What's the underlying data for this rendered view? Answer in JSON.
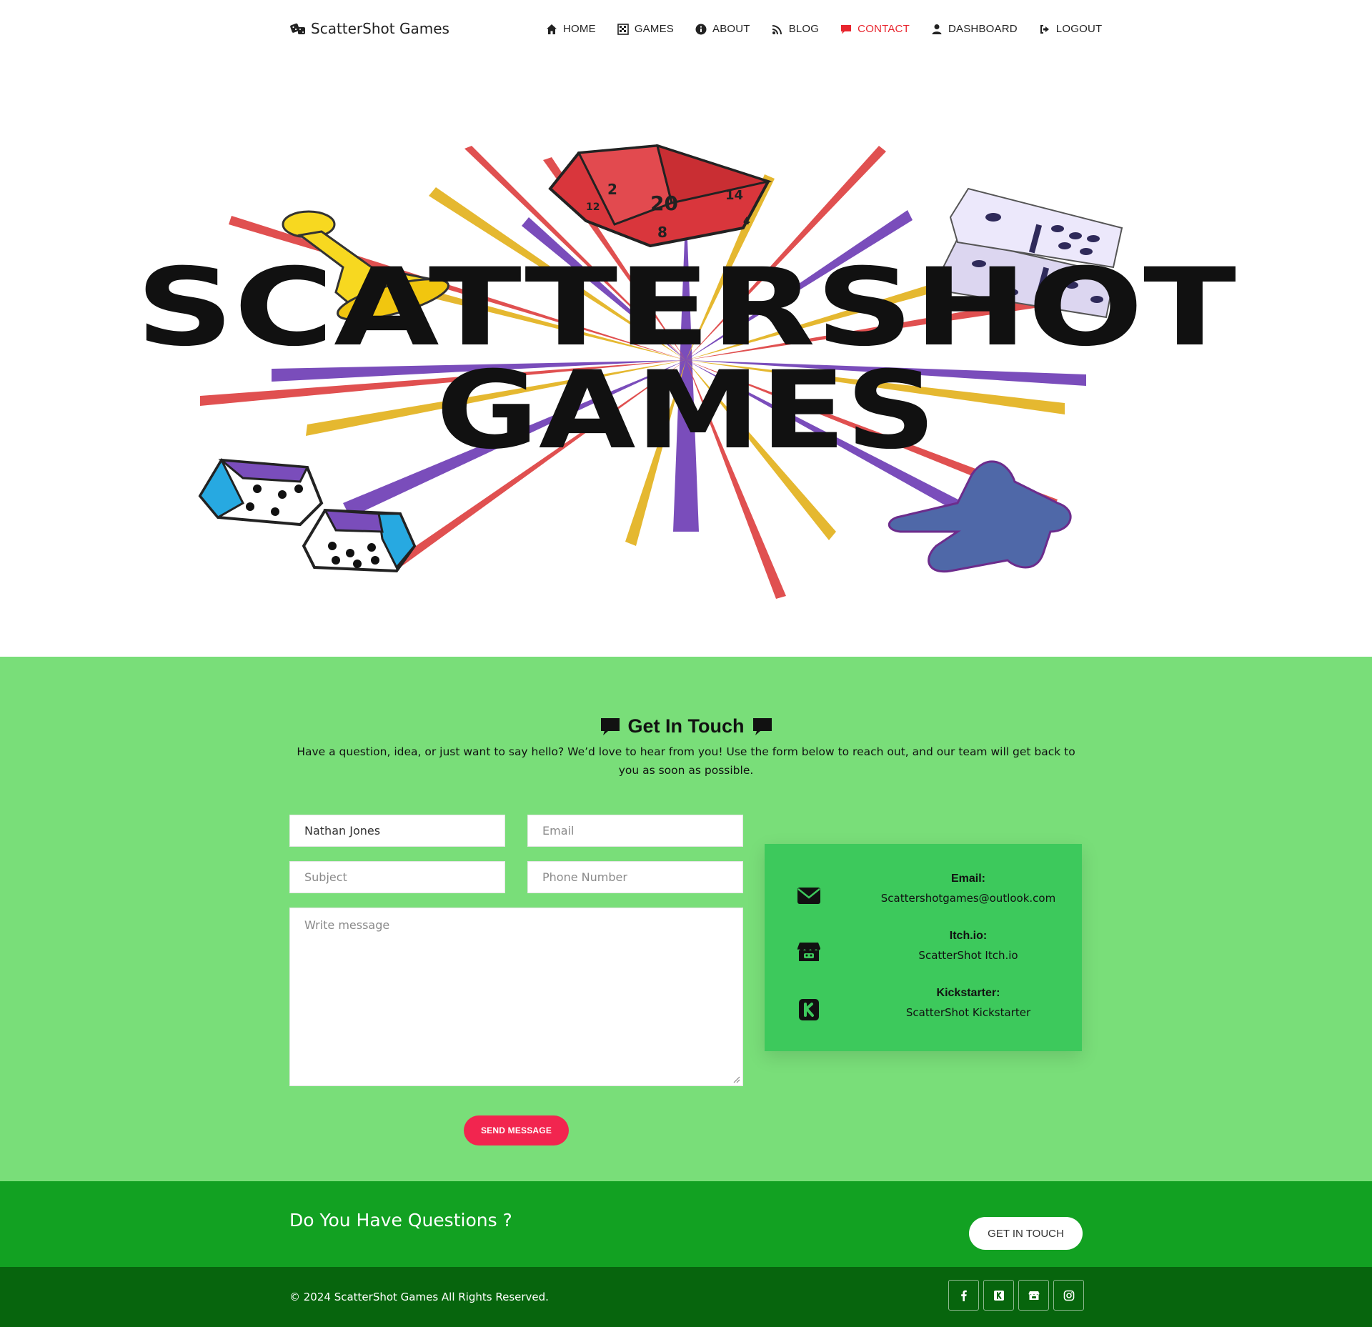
{
  "header": {
    "brand": "ScatterShot Games",
    "nav": [
      {
        "label": "HOME",
        "icon": "home-icon"
      },
      {
        "label": "GAMES",
        "icon": "chessboard-icon"
      },
      {
        "label": "ABOUT",
        "icon": "info-icon"
      },
      {
        "label": "BLOG",
        "icon": "blog-icon"
      },
      {
        "label": "CONTACT",
        "icon": "comment-icon",
        "active": true
      },
      {
        "label": "DASHBOARD",
        "icon": "user-icon"
      },
      {
        "label": "LOGOUT",
        "icon": "logout-icon"
      }
    ]
  },
  "hero": {
    "logo_line1": "SCATTERSHOT",
    "logo_line2": "GAMES",
    "die_numbers": [
      "2",
      "20",
      "14",
      "8",
      "12",
      "4"
    ]
  },
  "contact": {
    "title": "Get In Touch",
    "description": "Have a question, idea, or just want to say hello? We’d love to hear from you! Use the form below to reach out, and our team will get back to you as soon as possible.",
    "form": {
      "name_value": "Nathan Jones",
      "email_placeholder": "Email",
      "subject_placeholder": "Subject",
      "phone_placeholder": "Phone Number",
      "message_placeholder": "Write message",
      "send_label": "SEND MESSAGE"
    },
    "info": [
      {
        "label": "Email:",
        "value": "Scattershotgames@outlook.com",
        "icon": "envelope-icon"
      },
      {
        "label": "Itch.io:",
        "value": "ScatterShot Itch.io",
        "icon": "itchio-icon"
      },
      {
        "label": "Kickstarter:",
        "value": "ScatterShot Kickstarter",
        "icon": "kickstarter-icon"
      }
    ]
  },
  "cta": {
    "title": "Do You Have Questions ?",
    "button": "GET IN TOUCH"
  },
  "footer": {
    "copyright": "© 2024 ScatterShot Games All Rights Reserved.",
    "socials": [
      "facebook-icon",
      "kickstarter-icon",
      "itchio-icon",
      "instagram-icon"
    ]
  },
  "colors": {
    "nav_active": "#e8252e",
    "contact_bg": "#79de79",
    "info_card_bg": "#3dc95c",
    "send_button": "#f2254f",
    "cta_bg": "#12a122",
    "footer_bg": "#07650d"
  }
}
